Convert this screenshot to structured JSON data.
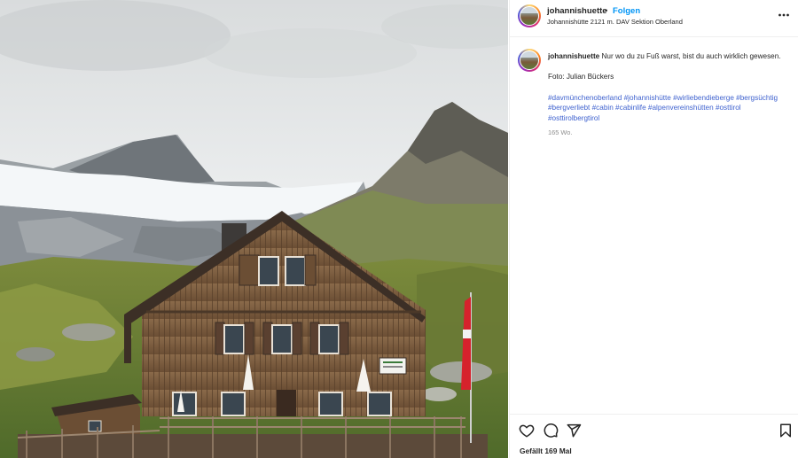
{
  "post": {
    "username": "johannishuette",
    "dot": "•",
    "follow_label": "Folgen",
    "location": "Johannishütte 2121 m. DAV Sektion Oberland",
    "caption_text": "Nur wo du zu Fuß warst, bist du auch wirklich gewesen.",
    "credit": "Foto: Julian Bückers",
    "hashtags": [
      "#davmünchenoberland",
      "#johannishütte",
      "#wirliebendieberge",
      "#bergsüchtig",
      "#bergverliebt",
      "#cabin",
      "#cabinlife",
      "#alpenvereinshütten",
      "#osttirol",
      "#osttirolbergtirol"
    ],
    "age": "165 Wo.",
    "likes": "Gefällt 169 Mal"
  },
  "icons": {
    "more": "more-options-icon",
    "like": "heart-icon",
    "comment": "comment-icon",
    "share": "share-icon",
    "save": "bookmark-icon"
  },
  "colors": {
    "follow": "#0095f6",
    "hashtag": "#3f62cf",
    "muted": "#8e8e8e",
    "text": "#262626"
  }
}
